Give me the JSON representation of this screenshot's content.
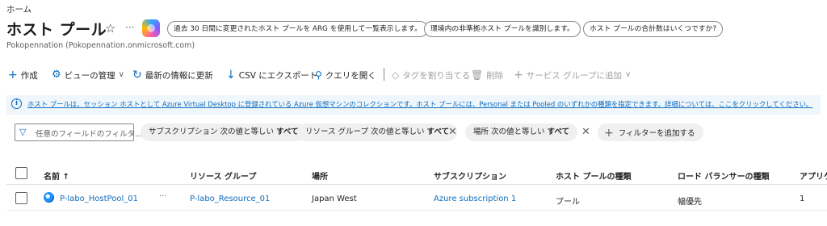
{
  "breadcrumb": {
    "home": "ホーム"
  },
  "header": {
    "title": "ホスト プール",
    "star_icon": "☆",
    "more_icon": "···",
    "subtitle": "Pokopennation (Pokopennation.onmicrosoft.com)",
    "copilot_icon": "copilot-icon"
  },
  "suggestions": [
    "過去 30 日間に変更されたホスト プールを ARG を使用して一覧表示します。",
    "環境内の非準拠ホスト プールを識別します。",
    "ホスト プールの合計数はいくつですか?"
  ],
  "toolbar": {
    "create": "作成",
    "manage_view": "ビューの管理",
    "refresh": "最新の情報に更新",
    "export_csv": "CSV にエクスポート",
    "open_query": "クエリを開く",
    "assign_tags": "タグを割り当てる",
    "delete": "削除",
    "add_service_group": "サービス グループに追加"
  },
  "info": {
    "text": "ホスト プールは、セッション ホストとして Azure Virtual Desktop に登録されている Azure 仮想マシンのコレクションです。ホスト プールには、Personal または Pooled のいずれかの種類を指定できます。詳細については、ここをクリックしてください。"
  },
  "filters": {
    "placeholder": "任意のフィールドのフィルタ...",
    "pills": [
      {
        "label": "サブスクリプション 次の値と等しい",
        "value": "すべて"
      },
      {
        "label": "リソース グループ 次の値と等しい",
        "value": "すべて"
      },
      {
        "label": "場所 次の値と等しい",
        "value": "すべて"
      }
    ],
    "add_filter": "フィルターを追加する"
  },
  "table": {
    "columns": [
      "名前 ↑",
      "リソース グループ",
      "場所",
      "サブスクリプション",
      "ホスト プールの種類",
      "ロード バランサーの種類",
      "アプリケ"
    ],
    "rows": [
      {
        "name": "P-labo_HostPool_01",
        "more": "···",
        "resource_group": "P-labo_Resource_01",
        "location": "Japan West",
        "subscription": "Azure subscription 1",
        "pool_type": "プール",
        "lb_type": "幅優先",
        "app_groups": "1"
      }
    ]
  },
  "colors": {
    "accent": "#0f6cbd",
    "info_bg": "#eff6fc",
    "pill_bg": "#f0f0f0"
  }
}
